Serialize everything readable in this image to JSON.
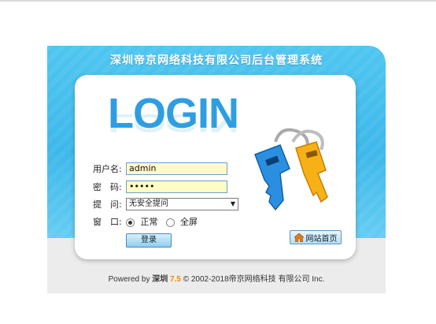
{
  "title": "深圳帝京网络科技有限公司后台管理系统",
  "login_word": "LOGIN",
  "form": {
    "username_label": "用户名:",
    "username_value": "admin",
    "password_label": "密　码:",
    "password_value": "•••••",
    "question_label": "提　问:",
    "question_value": "无安全提问",
    "window_label": "窗　口:",
    "window_options": [
      "正常",
      "全屏"
    ],
    "window_selected": "正常",
    "login_button": "登录"
  },
  "home_button": "网站首页",
  "footer": {
    "powered_by": "Powered by",
    "brand": "深圳",
    "version": "7.5",
    "copyright": "© 2002-2018帝京网络科技 有限公司 Inc."
  },
  "colors": {
    "accent": "#3db8ea",
    "input_bg": "#fffdc7",
    "version": "#f08a00"
  }
}
